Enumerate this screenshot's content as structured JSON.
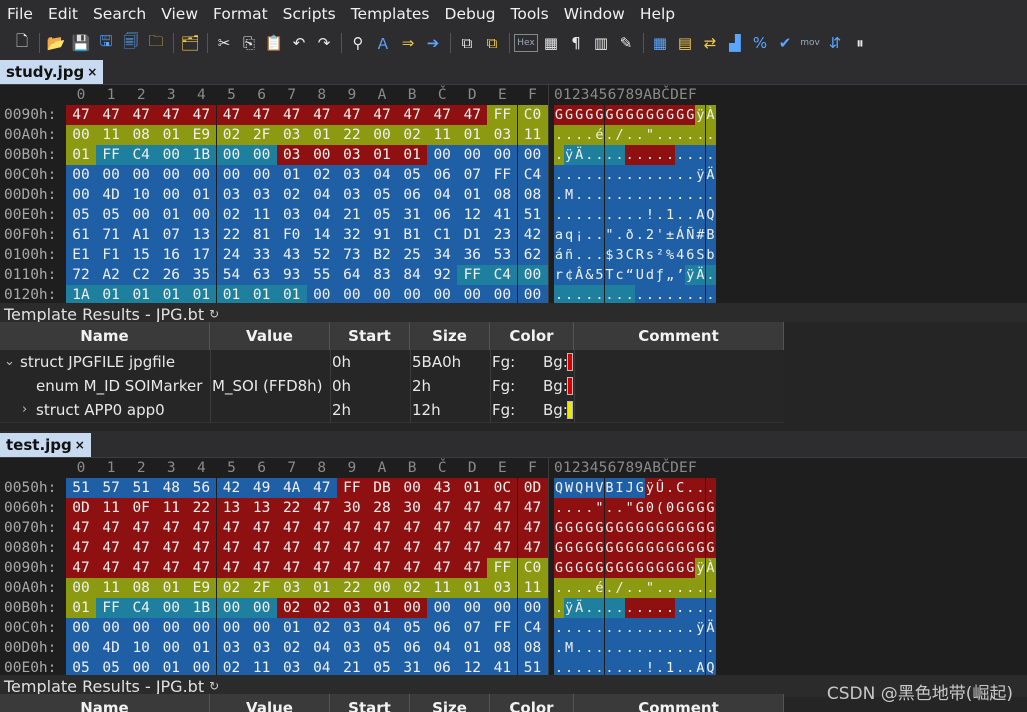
{
  "menu": [
    "File",
    "Edit",
    "Search",
    "View",
    "Format",
    "Scripts",
    "Templates",
    "Debug",
    "Tools",
    "Window",
    "Help"
  ],
  "toolbar_icons": [
    "new-file-icon",
    "open-folder-icon",
    "save-icon",
    "save-as-icon",
    "save-all-icon",
    "close-icon",
    "copy-file-icon",
    "cut-icon",
    "copy-icon",
    "paste-icon",
    "undo-icon",
    "redo-icon",
    "find-icon",
    "find-replace-icon",
    "goto-icon",
    "next-icon",
    "compare-icon",
    "compare2-icon",
    "hex-icon",
    "binary-icon",
    "pilcrow-icon",
    "columns-icon",
    "highlight-icon",
    "calculator-icon",
    "template-icon",
    "swap-icon",
    "histogram-icon",
    "percent-icon",
    "checksum-icon",
    "mov-icon",
    "convert-icon",
    "pause-icon"
  ],
  "toolbar_hex_label": "Hex",
  "toolbar_mov_label": "mov",
  "pane1": {
    "tab": "study.jpg",
    "close": "×",
    "header": [
      "0",
      "1",
      "2",
      "3",
      "4",
      "5",
      "6",
      "7",
      "8",
      "9",
      "A",
      "B",
      "Č",
      "D",
      "E",
      "F"
    ],
    "ascii_header": "0123456789ABČDEF",
    "rows": [
      {
        "addr": "0090h:",
        "bytes": [
          "47",
          "47",
          "47",
          "47",
          "47",
          "47",
          "47",
          "47",
          "47",
          "47",
          "47",
          "47",
          "47",
          "47",
          "FF",
          "C0"
        ],
        "colors": [
          "r",
          "r",
          "r",
          "r",
          "r",
          "r",
          "r",
          "r",
          "r",
          "r",
          "r",
          "r",
          "r",
          "r",
          "y",
          "y"
        ],
        "ascii": "GGGGGGGGGGGGGGÿÀ"
      },
      {
        "addr": "00A0h:",
        "bytes": [
          "00",
          "11",
          "08",
          "01",
          "E9",
          "02",
          "2F",
          "03",
          "01",
          "22",
          "00",
          "02",
          "11",
          "01",
          "03",
          "11"
        ],
        "colors": [
          "y",
          "y",
          "y",
          "y",
          "y",
          "y",
          "y",
          "y",
          "y",
          "y",
          "y",
          "y",
          "y",
          "y",
          "y",
          "y"
        ],
        "ascii": "....é./..\"......"
      },
      {
        "addr": "00B0h:",
        "bytes": [
          "01",
          "FF",
          "C4",
          "00",
          "1B",
          "00",
          "00",
          "03",
          "00",
          "03",
          "01",
          "01",
          "00",
          "00",
          "00",
          "00"
        ],
        "colors": [
          "y",
          "t",
          "t",
          "t",
          "t",
          "t",
          "t",
          "r",
          "r",
          "r",
          "r",
          "r",
          "b",
          "b",
          "b",
          "b"
        ],
        "ascii": ".ÿÄ............."
      },
      {
        "addr": "00C0h:",
        "bytes": [
          "00",
          "00",
          "00",
          "00",
          "00",
          "00",
          "00",
          "01",
          "02",
          "03",
          "04",
          "05",
          "06",
          "07",
          "FF",
          "C4"
        ],
        "colors": [
          "b",
          "b",
          "b",
          "b",
          "b",
          "b",
          "b",
          "b",
          "b",
          "b",
          "b",
          "b",
          "b",
          "b",
          "b",
          "b"
        ],
        "ascii": "..............ÿÄ"
      },
      {
        "addr": "00D0h:",
        "bytes": [
          "00",
          "4D",
          "10",
          "00",
          "01",
          "03",
          "03",
          "02",
          "04",
          "03",
          "05",
          "06",
          "04",
          "01",
          "08",
          "08"
        ],
        "colors": [
          "b",
          "b",
          "b",
          "b",
          "b",
          "b",
          "b",
          "b",
          "b",
          "b",
          "b",
          "b",
          "b",
          "b",
          "b",
          "b"
        ],
        "ascii": ".M.............."
      },
      {
        "addr": "00E0h:",
        "bytes": [
          "05",
          "05",
          "00",
          "01",
          "00",
          "02",
          "11",
          "03",
          "04",
          "21",
          "05",
          "31",
          "06",
          "12",
          "41",
          "51"
        ],
        "colors": [
          "b",
          "b",
          "b",
          "b",
          "b",
          "b",
          "b",
          "b",
          "b",
          "b",
          "b",
          "b",
          "b",
          "b",
          "b",
          "b"
        ],
        "ascii": ".........!.1..AQ"
      },
      {
        "addr": "00F0h:",
        "bytes": [
          "61",
          "71",
          "A1",
          "07",
          "13",
          "22",
          "81",
          "F0",
          "14",
          "32",
          "91",
          "B1",
          "C1",
          "D1",
          "23",
          "42"
        ],
        "colors": [
          "b",
          "b",
          "b",
          "b",
          "b",
          "b",
          "b",
          "b",
          "b",
          "b",
          "b",
          "b",
          "b",
          "b",
          "b",
          "b"
        ],
        "ascii": "aq¡..\".ð.2'±ÁÑ#B"
      },
      {
        "addr": "0100h:",
        "bytes": [
          "E1",
          "F1",
          "15",
          "16",
          "17",
          "24",
          "33",
          "43",
          "52",
          "73",
          "B2",
          "25",
          "34",
          "36",
          "53",
          "62"
        ],
        "colors": [
          "b",
          "b",
          "b",
          "b",
          "b",
          "b",
          "b",
          "b",
          "b",
          "b",
          "b",
          "b",
          "b",
          "b",
          "b",
          "b"
        ],
        "ascii": "áñ...$3CRs²%46Sb"
      },
      {
        "addr": "0110h:",
        "bytes": [
          "72",
          "A2",
          "C2",
          "26",
          "35",
          "54",
          "63",
          "93",
          "55",
          "64",
          "83",
          "84",
          "92",
          "FF",
          "C4",
          "00"
        ],
        "colors": [
          "b",
          "b",
          "b",
          "b",
          "b",
          "b",
          "b",
          "b",
          "b",
          "b",
          "b",
          "b",
          "b",
          "t",
          "t",
          "t"
        ],
        "ascii": "r¢Â&5Tc“Udƒ„’ÿÄ."
      },
      {
        "addr": "0120h:",
        "bytes": [
          "1A",
          "01",
          "01",
          "01",
          "01",
          "01",
          "01",
          "01",
          "00",
          "00",
          "00",
          "00",
          "00",
          "00",
          "00",
          "00"
        ],
        "colors": [
          "t",
          "t",
          "t",
          "t",
          "t",
          "t",
          "t",
          "t",
          "b",
          "b",
          "b",
          "b",
          "b",
          "b",
          "b",
          "b"
        ],
        "ascii": "................"
      }
    ]
  },
  "template1": {
    "title": "Template Results - JPG.bt",
    "refresh": "↻",
    "columns": [
      "Name",
      "Value",
      "Start",
      "Size",
      "Color",
      "Comment"
    ],
    "rows": [
      {
        "expander": "⌄",
        "name": "struct JPGFILE jpgfile",
        "value": "",
        "start": "0h",
        "size": "5BA0h",
        "fg": "Fg:",
        "bg": "Bg:",
        "bgcolor": "#d40000",
        "indent": 0
      },
      {
        "expander": "",
        "name": "enum M_ID SOIMarker",
        "value": "M_SOI (FFD8h)",
        "start": "0h",
        "size": "2h",
        "fg": "Fg:",
        "bg": "Bg:",
        "bgcolor": "#d40000",
        "indent": 1
      },
      {
        "expander": "›",
        "name": "struct APP0 app0",
        "value": "",
        "start": "2h",
        "size": "12h",
        "fg": "Fg:",
        "bg": "Bg:",
        "bgcolor": "#e8e800",
        "indent": 1
      }
    ]
  },
  "pane2": {
    "tab": "test.jpg",
    "close": "×",
    "header": [
      "0",
      "1",
      "2",
      "3",
      "4",
      "5",
      "6",
      "7",
      "8",
      "9",
      "A",
      "B",
      "Č",
      "D",
      "E",
      "F"
    ],
    "ascii_header": "0123456789ABČDEF",
    "rows": [
      {
        "addr": "0050h:",
        "bytes": [
          "51",
          "57",
          "51",
          "48",
          "56",
          "42",
          "49",
          "4A",
          "47",
          "FF",
          "DB",
          "00",
          "43",
          "01",
          "0C",
          "0D"
        ],
        "colors": [
          "b",
          "b",
          "b",
          "b",
          "b",
          "b",
          "b",
          "b",
          "b",
          "r",
          "r",
          "r",
          "r",
          "r",
          "r",
          "r"
        ],
        "ascii": "QWQHVBIJGÿÛ.C..."
      },
      {
        "addr": "0060h:",
        "bytes": [
          "0D",
          "11",
          "0F",
          "11",
          "22",
          "13",
          "13",
          "22",
          "47",
          "30",
          "28",
          "30",
          "47",
          "47",
          "47",
          "47"
        ],
        "colors": [
          "r",
          "r",
          "r",
          "r",
          "r",
          "r",
          "r",
          "r",
          "r",
          "r",
          "r",
          "r",
          "r",
          "r",
          "r",
          "r"
        ],
        "ascii": "....\"..\"G0(0GGGG"
      },
      {
        "addr": "0070h:",
        "bytes": [
          "47",
          "47",
          "47",
          "47",
          "47",
          "47",
          "47",
          "47",
          "47",
          "47",
          "47",
          "47",
          "47",
          "47",
          "47",
          "47"
        ],
        "colors": [
          "r",
          "r",
          "r",
          "r",
          "r",
          "r",
          "r",
          "r",
          "r",
          "r",
          "r",
          "r",
          "r",
          "r",
          "r",
          "r"
        ],
        "ascii": "GGGGGGGGGGGGGGGG"
      },
      {
        "addr": "0080h:",
        "bytes": [
          "47",
          "47",
          "47",
          "47",
          "47",
          "47",
          "47",
          "47",
          "47",
          "47",
          "47",
          "47",
          "47",
          "47",
          "47",
          "47"
        ],
        "colors": [
          "r",
          "r",
          "r",
          "r",
          "r",
          "r",
          "r",
          "r",
          "r",
          "r",
          "r",
          "r",
          "r",
          "r",
          "r",
          "r"
        ],
        "ascii": "GGGGGGGGGGGGGGGG"
      },
      {
        "addr": "0090h:",
        "bytes": [
          "47",
          "47",
          "47",
          "47",
          "47",
          "47",
          "47",
          "47",
          "47",
          "47",
          "47",
          "47",
          "47",
          "47",
          "FF",
          "C0"
        ],
        "colors": [
          "r",
          "r",
          "r",
          "r",
          "r",
          "r",
          "r",
          "r",
          "r",
          "r",
          "r",
          "r",
          "r",
          "r",
          "y",
          "y"
        ],
        "ascii": "GGGGGGGGGGGGGGÿÀ"
      },
      {
        "addr": "00A0h:",
        "bytes": [
          "00",
          "11",
          "08",
          "01",
          "E9",
          "02",
          "2F",
          "03",
          "01",
          "22",
          "00",
          "02",
          "11",
          "01",
          "03",
          "11"
        ],
        "colors": [
          "y",
          "y",
          "y",
          "y",
          "y",
          "y",
          "y",
          "y",
          "y",
          "y",
          "y",
          "y",
          "y",
          "y",
          "y",
          "y"
        ],
        "ascii": "....é./..\"......"
      },
      {
        "addr": "00B0h:",
        "bytes": [
          "01",
          "FF",
          "C4",
          "00",
          "1B",
          "00",
          "00",
          "02",
          "02",
          "03",
          "01",
          "00",
          "00",
          "00",
          "00",
          "00"
        ],
        "colors": [
          "y",
          "t",
          "t",
          "t",
          "t",
          "t",
          "t",
          "r",
          "r",
          "r",
          "r",
          "r",
          "b",
          "b",
          "b",
          "b"
        ],
        "ascii": ".ÿÄ............."
      },
      {
        "addr": "00C0h:",
        "bytes": [
          "00",
          "00",
          "00",
          "00",
          "00",
          "00",
          "00",
          "01",
          "02",
          "03",
          "04",
          "05",
          "06",
          "07",
          "FF",
          "C4"
        ],
        "colors": [
          "b",
          "b",
          "b",
          "b",
          "b",
          "b",
          "b",
          "b",
          "b",
          "b",
          "b",
          "b",
          "b",
          "b",
          "b",
          "b"
        ],
        "ascii": "..............ÿÄ"
      },
      {
        "addr": "00D0h:",
        "bytes": [
          "00",
          "4D",
          "10",
          "00",
          "01",
          "03",
          "03",
          "02",
          "04",
          "03",
          "05",
          "06",
          "04",
          "01",
          "08",
          "08"
        ],
        "colors": [
          "b",
          "b",
          "b",
          "b",
          "b",
          "b",
          "b",
          "b",
          "b",
          "b",
          "b",
          "b",
          "b",
          "b",
          "b",
          "b"
        ],
        "ascii": ".M.............."
      },
      {
        "addr": "00E0h:",
        "bytes": [
          "05",
          "05",
          "00",
          "01",
          "00",
          "02",
          "11",
          "03",
          "04",
          "21",
          "05",
          "31",
          "06",
          "12",
          "41",
          "51"
        ],
        "colors": [
          "b",
          "b",
          "b",
          "b",
          "b",
          "b",
          "b",
          "b",
          "b",
          "b",
          "b",
          "b",
          "b",
          "b",
          "b",
          "b"
        ],
        "ascii": ".........!.1..AQ"
      }
    ]
  },
  "template2": {
    "title": "Template Results - JPG.bt",
    "refresh": "↻",
    "columns": [
      "Name",
      "Value",
      "Start",
      "Size",
      "Color",
      "Comment"
    ]
  },
  "watermark": "CSDN @黑色地带(崛起)",
  "palette": {
    "r": "#8e1010",
    "y": "#8b9a10",
    "t": "#1f7f9e",
    "b": "#1f5fa6"
  }
}
